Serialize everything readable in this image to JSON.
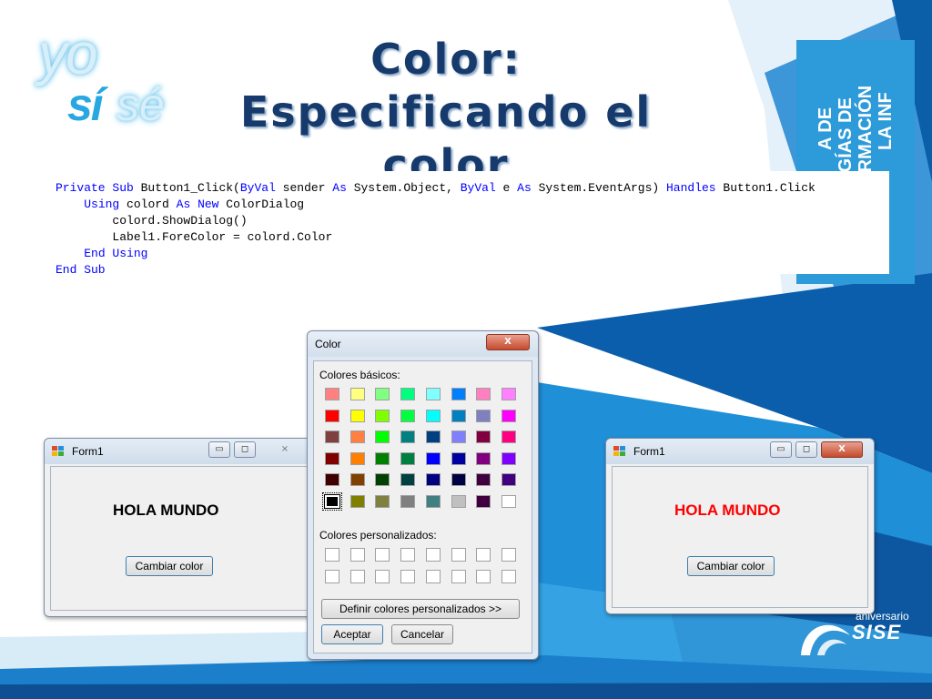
{
  "slide": {
    "title_line1": "Color: Especificando el",
    "title_line2": "color",
    "logo": {
      "yo": "yo",
      "si": "sí",
      "se": "sé"
    },
    "side_banner": {
      "line1": "A DE",
      "line2": "OGÍAS DE",
      "line3": "ORMACIÓN",
      "line4": "LA INF"
    },
    "anniversary": {
      "top": "aniversario",
      "brand": "SISE"
    }
  },
  "code": {
    "lines": [
      [
        {
          "t": "Private",
          "k": true
        },
        {
          "t": " "
        },
        {
          "t": "Sub",
          "k": true
        },
        {
          "t": " Button1_Click("
        },
        {
          "t": "ByVal",
          "k": true
        },
        {
          "t": " sender "
        },
        {
          "t": "As",
          "k": true
        },
        {
          "t": " System.Object, "
        },
        {
          "t": "ByVal",
          "k": true
        },
        {
          "t": " e "
        },
        {
          "t": "As",
          "k": true
        },
        {
          "t": " System.EventArgs) "
        },
        {
          "t": "Handles",
          "k": true
        },
        {
          "t": " Button1.Click"
        }
      ],
      [
        {
          "t": "    "
        },
        {
          "t": "Using",
          "k": true
        },
        {
          "t": " colord "
        },
        {
          "t": "As",
          "k": true
        },
        {
          "t": " "
        },
        {
          "t": "New",
          "k": true
        },
        {
          "t": " ColorDialog"
        }
      ],
      [
        {
          "t": "        colord.ShowDialog()"
        }
      ],
      [
        {
          "t": "        Label1.ForeColor = colord.Color"
        }
      ],
      [
        {
          "t": "    "
        },
        {
          "t": "End Using",
          "k": true
        }
      ],
      [
        {
          "t": "End Sub",
          "k": true
        }
      ]
    ]
  },
  "form_left": {
    "title": "Form1",
    "label": "HOLA MUNDO",
    "label_color": "#000000",
    "button": "Cambiar color",
    "controls": {
      "minimize": "▭",
      "maximize": "◻",
      "close": "⨯"
    }
  },
  "form_right": {
    "title": "Form1",
    "label": "HOLA MUNDO",
    "label_color": "#ff0000",
    "button": "Cambiar color",
    "controls": {
      "minimize": "▭",
      "maximize": "◻",
      "close": "X"
    }
  },
  "color_dialog": {
    "title": "Color",
    "close": "X",
    "basic_label": "Colores básicos:",
    "custom_label": "Colores personalizados:",
    "define_button": "Definir colores personalizados >>",
    "ok_button": "Aceptar",
    "cancel_button": "Cancelar",
    "basic_colors": [
      [
        "#ff8080",
        "#ffff80",
        "#80ff80",
        "#00ff80",
        "#80ffff",
        "#0080ff",
        "#ff80c0",
        "#ff80ff"
      ],
      [
        "#ff0000",
        "#ffff00",
        "#80ff00",
        "#00ff40",
        "#00ffff",
        "#0080c0",
        "#8080c0",
        "#ff00ff"
      ],
      [
        "#804040",
        "#ff8040",
        "#00ff00",
        "#008080",
        "#004080",
        "#8080ff",
        "#800040",
        "#ff0080"
      ],
      [
        "#800000",
        "#ff8000",
        "#008000",
        "#008040",
        "#0000ff",
        "#0000a0",
        "#800080",
        "#8000ff"
      ],
      [
        "#400000",
        "#804000",
        "#004000",
        "#004040",
        "#000080",
        "#000040",
        "#400040",
        "#400080"
      ],
      [
        "#000000",
        "#808000",
        "#808040",
        "#808080",
        "#408080",
        "#c0c0c0",
        "#400040",
        "#ffffff"
      ]
    ],
    "selected_index": [
      5,
      0
    ],
    "custom_rows": 2,
    "custom_cols": 8
  }
}
